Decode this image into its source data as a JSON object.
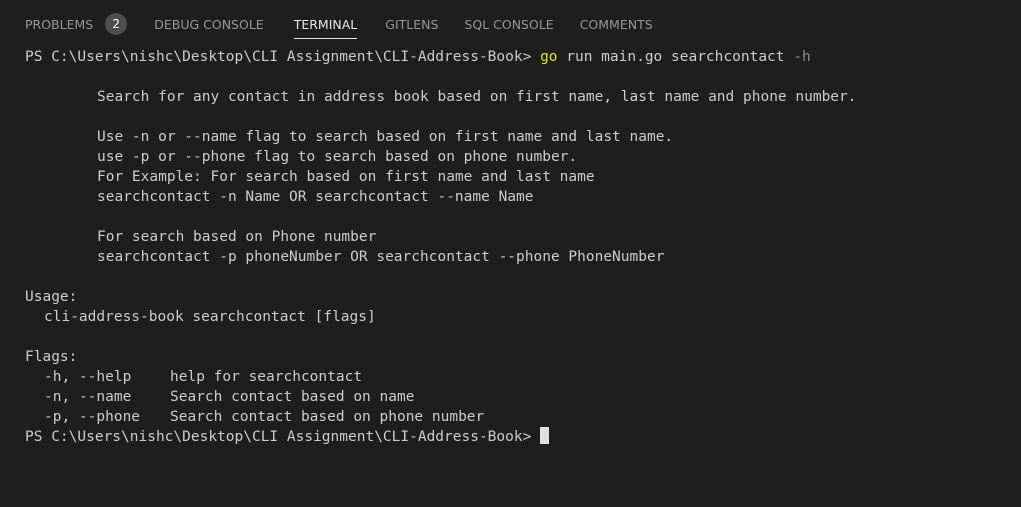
{
  "tabs": [
    {
      "label": "PROBLEMS",
      "badge": "2"
    },
    {
      "label": "DEBUG CONSOLE"
    },
    {
      "label": "TERMINAL"
    },
    {
      "label": "GITLENS"
    },
    {
      "label": "SQL CONSOLE"
    },
    {
      "label": "COMMENTS"
    }
  ],
  "active_tab": "TERMINAL",
  "terminal": {
    "prompt": "PS C:\\Users\\nishc\\Desktop\\CLI Assignment\\CLI-Address-Book> ",
    "command": {
      "keyword": "go",
      "rest": " run main.go searchcontact ",
      "arg": "-h"
    },
    "description": "Search for any contact in address book based on first name, last name and phone number.",
    "help_lines": [
      "Use -n or --name flag to search based on first name and last name.",
      "use -p or --phone flag to search based on phone number.",
      "For Example: For search based on first name and last name",
      "searchcontact -n Name OR searchcontact --name Name"
    ],
    "phone_lines": [
      "For search based on Phone number",
      "searchcontact -p phoneNumber OR searchcontact --phone PhoneNumber"
    ],
    "usage_header": "Usage:",
    "usage_line": "cli-address-book searchcontact [flags]",
    "flags_header": "Flags:",
    "flags": [
      {
        "key": "-h, --help",
        "desc": "help for searchcontact"
      },
      {
        "key": "-n, --name",
        "desc": "Search contact based on name"
      },
      {
        "key": "-p, --phone",
        "desc": "Search contact based on phone number"
      }
    ],
    "final_prompt": "PS C:\\Users\\nishc\\Desktop\\CLI Assignment\\CLI-Address-Book> "
  },
  "colors": {
    "background": "#1e1e1e",
    "text": "#cccccc",
    "go_keyword": "#e5e510",
    "flag_arg": "#8c8c8c",
    "tab_inactive": "#969696",
    "tab_active": "#e7e7e7",
    "badge_bg": "#4d4d4d"
  }
}
